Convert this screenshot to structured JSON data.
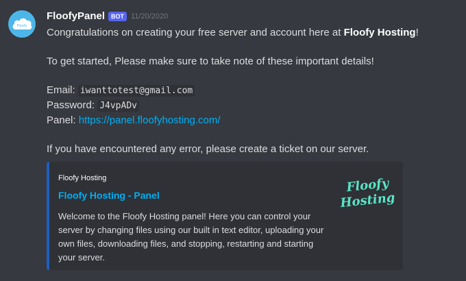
{
  "message": {
    "username": "FloofyPanel",
    "badge": "BOT",
    "timestamp": "11/20/2020",
    "line1_prefix": "Congratulations on creating your free server and account here at ",
    "line1_bold": "Floofy Hosting",
    "line1_suffix": "!",
    "line2": "To get started, Please make sure to take note of these important details!",
    "email_label": "Email:",
    "email_value": "iwanttotest@gmail.com",
    "password_label": "Password:",
    "password_value": "J4vpADv",
    "panel_label": "Panel:",
    "panel_link": "https://panel.floofyhosting.com/",
    "line_error": "If you have encountered any error, please create a ticket on our server."
  },
  "embed": {
    "author": "Floofy Hosting",
    "title": "Floofy Hosting - Panel",
    "description": "Welcome to the Floofy Hosting panel! Here you can control your server by changing files using our built in text editor, uploading your own files, downloading files, and stopping, restarting and starting your server.",
    "thumbnail_text_1": "Floofy",
    "thumbnail_text_2": "Hosting",
    "accent_color": "#1f5fbf",
    "thumbnail_color": "#57e6c7"
  },
  "colors": {
    "background": "#36393f",
    "link": "#00aff4",
    "badge": "#5865f2"
  },
  "avatar": {
    "icon": "cloud-icon"
  }
}
